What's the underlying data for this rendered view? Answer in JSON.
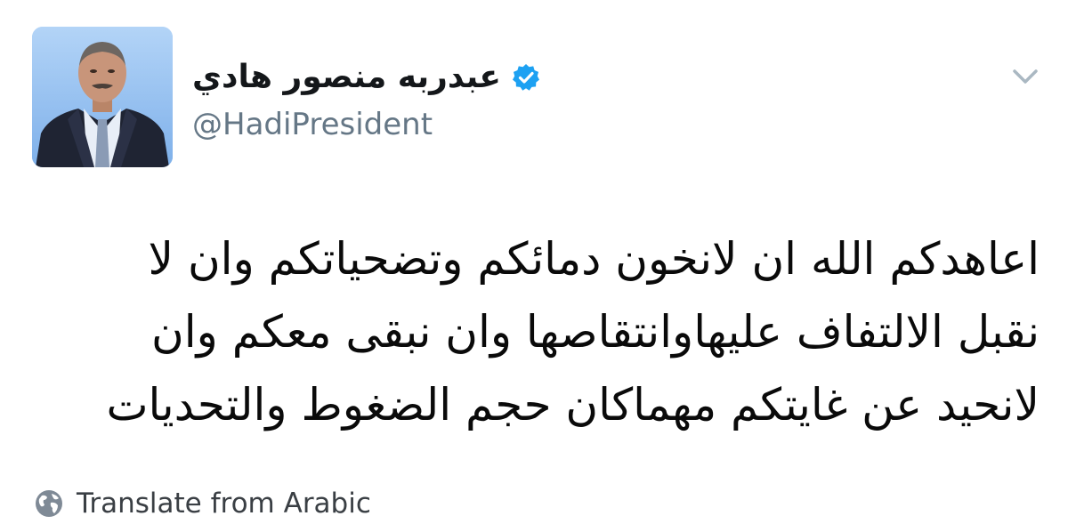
{
  "profile": {
    "display_name": "عبدربه منصور هادي",
    "handle": "@HadiPresident",
    "verified": true,
    "avatar_icon": "profile-photo"
  },
  "tweet": {
    "lines": [
      "اعاهدكم الله ان لانخون دمائكم وتضحياتكم وان لا",
      "نقبل الالتفاف عليهاوانتقاصها وان نبقى معكم وان",
      "لانحيد عن غايتكم مهماكان حجم الضغوط  والتحديات"
    ]
  },
  "translate": {
    "label": "Translate from Arabic",
    "icon": "globe-icon"
  },
  "menu": {
    "icon": "chevron-down-icon"
  },
  "colors": {
    "verified_blue": "#1da1f2",
    "handle_gray": "#657786",
    "chevron_gray": "#aab8c2",
    "text_black": "#14171a"
  }
}
